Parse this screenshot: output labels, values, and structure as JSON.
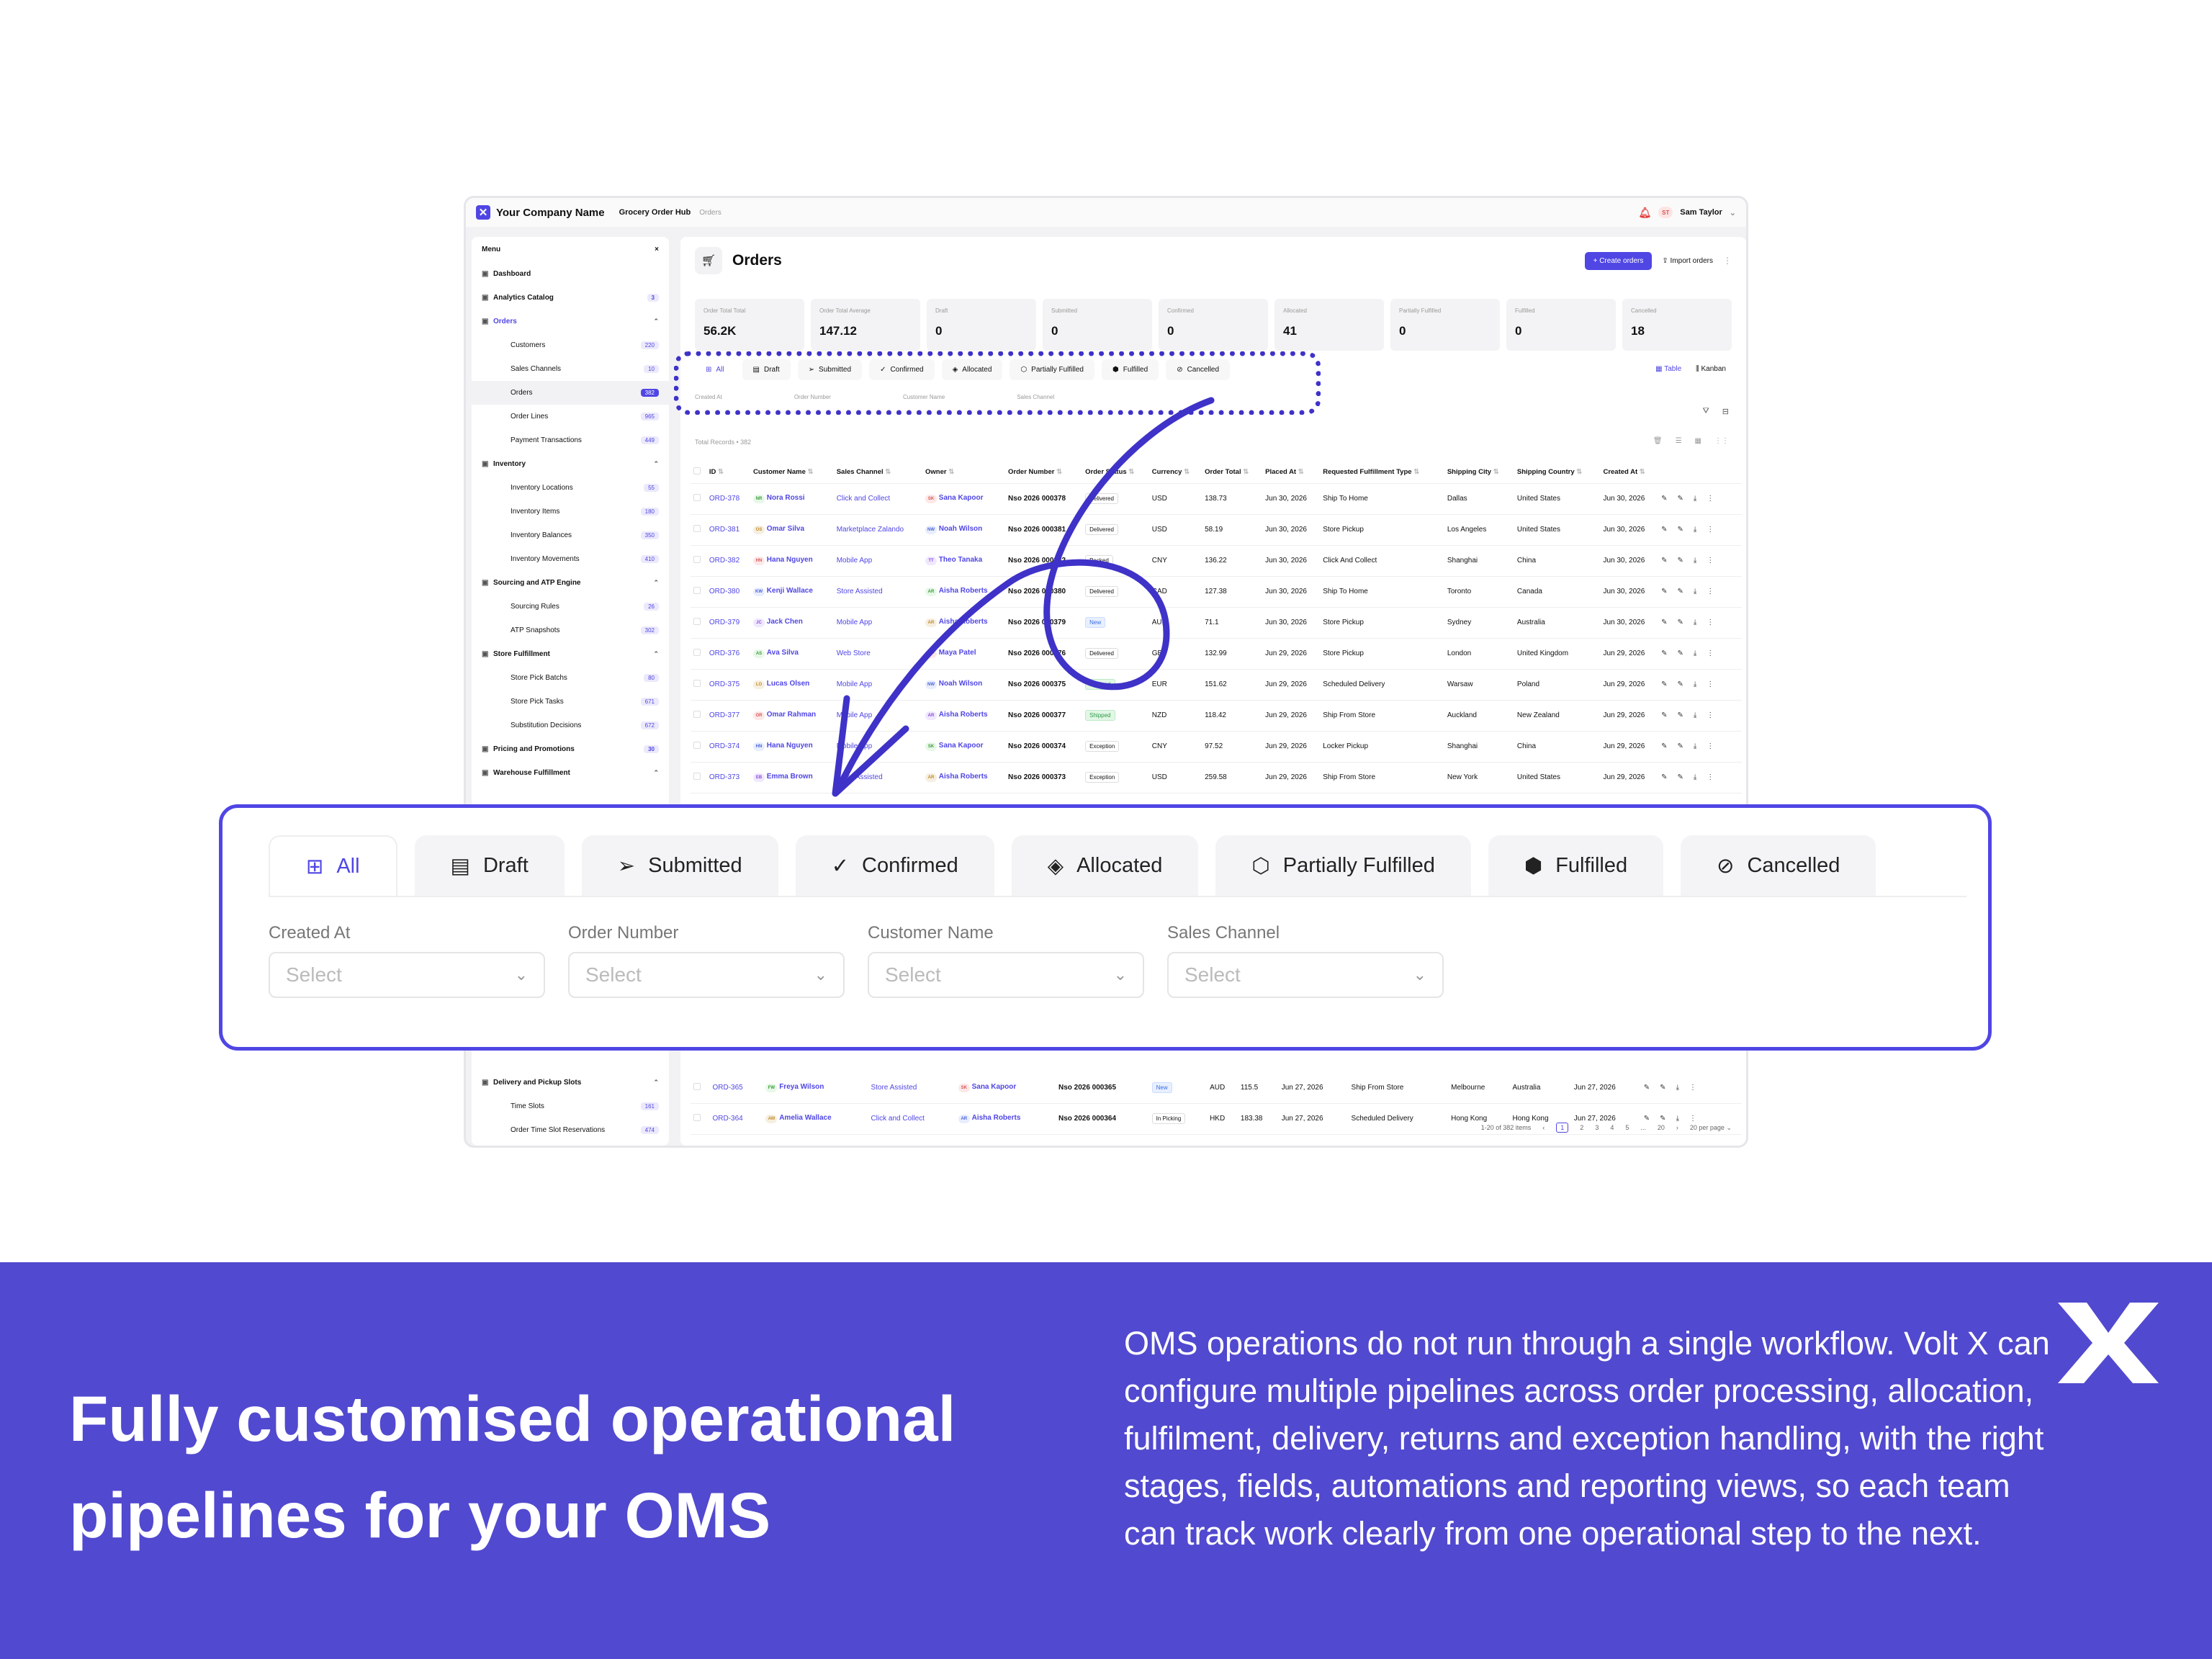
{
  "app": {
    "company": "Your Company Name",
    "hub": "Grocery Order Hub",
    "breadcrumb": "Orders",
    "user": {
      "initials": "ST",
      "name": "Sam Taylor"
    }
  },
  "sidebar": {
    "header": "Menu",
    "close": "×",
    "items": [
      {
        "label": "Dashboard",
        "level": 0
      },
      {
        "label": "Analytics Catalog",
        "badge": "3",
        "level": 0
      },
      {
        "label": "Orders",
        "level": 0,
        "section": true,
        "open": true
      },
      {
        "label": "Customers",
        "badge": "220",
        "level": 1
      },
      {
        "label": "Sales Channels",
        "badge": "10",
        "level": 1
      },
      {
        "label": "Orders",
        "badge": "382",
        "level": 1,
        "active": true
      },
      {
        "label": "Order Lines",
        "badge": "965",
        "level": 1
      },
      {
        "label": "Payment Transactions",
        "badge": "449",
        "level": 1
      },
      {
        "label": "Inventory",
        "level": 0,
        "open": true
      },
      {
        "label": "Inventory Locations",
        "badge": "55",
        "level": 1
      },
      {
        "label": "Inventory Items",
        "badge": "180",
        "level": 1
      },
      {
        "label": "Inventory Balances",
        "badge": "350",
        "level": 1
      },
      {
        "label": "Inventory Movements",
        "badge": "410",
        "level": 1
      },
      {
        "label": "Sourcing and ATP Engine",
        "level": 0,
        "open": true
      },
      {
        "label": "Sourcing Rules",
        "badge": "26",
        "level": 1
      },
      {
        "label": "ATP Snapshots",
        "badge": "302",
        "level": 1
      },
      {
        "label": "Store Fulfillment",
        "level": 0,
        "open": true
      },
      {
        "label": "Store Pick Batchs",
        "badge": "80",
        "level": 1
      },
      {
        "label": "Store Pick Tasks",
        "badge": "671",
        "level": 1
      },
      {
        "label": "Substitution Decisions",
        "badge": "672",
        "level": 1
      },
      {
        "label": "Pricing and Promotions",
        "badge": "30",
        "level": 0
      },
      {
        "label": "Warehouse Fulfillment",
        "level": 0,
        "open": true
      }
    ],
    "bottom_items": [
      {
        "label": "Delivery and Pickup Slots",
        "level": 0,
        "open": true
      },
      {
        "label": "Time Slots",
        "badge": "161",
        "level": 1
      },
      {
        "label": "Order Time Slot Reservations",
        "badge": "474",
        "level": 1
      }
    ]
  },
  "main": {
    "title": "Orders",
    "create_label": "+ Create orders",
    "import_label": "Import orders",
    "stats": [
      {
        "label": "Order Total Total",
        "value": "56.2K"
      },
      {
        "label": "Order Total Average",
        "value": "147.12"
      },
      {
        "label": "Draft",
        "value": "0"
      },
      {
        "label": "Submitted",
        "value": "0"
      },
      {
        "label": "Confirmed",
        "value": "0"
      },
      {
        "label": "Allocated",
        "value": "41"
      },
      {
        "label": "Partially Fulfilled",
        "value": "0"
      },
      {
        "label": "Fulfilled",
        "value": "0"
      },
      {
        "label": "Cancelled",
        "value": "18"
      }
    ],
    "tabs": [
      "All",
      "Draft",
      "Submitted",
      "Confirmed",
      "Allocated",
      "Partially Fulfilled",
      "Fulfilled",
      "Cancelled"
    ],
    "tab_icons": [
      "grid-icon",
      "document-icon",
      "send-icon",
      "check-circle-icon",
      "layers-icon",
      "box-icon",
      "box-check-icon",
      "ban-icon"
    ],
    "views": [
      "Table",
      "Kanban"
    ],
    "filters": [
      "Created At",
      "Order Number",
      "Customer Name",
      "Sales Channel"
    ],
    "filter_placeholder": "Select",
    "records": "Total Records • 382",
    "columns": [
      "ID",
      "Customer Name",
      "Sales Channel",
      "Owner",
      "Order Number",
      "Order Status",
      "Currency",
      "Order Total",
      "Placed At",
      "Requested Fulfillment Type",
      "Shipping City",
      "Shipping Country",
      "Created At"
    ],
    "rows": [
      [
        "ORD-378",
        "NR",
        "Nora Rossi",
        "Click and Collect",
        "SK",
        "Sana Kapoor",
        "Nso 2026 000378",
        "Delivered",
        "USD",
        "138.73",
        "Jun 30, 2026",
        "Ship To Home",
        "Dallas",
        "United States",
        "Jun 30, 2026"
      ],
      [
        "ORD-381",
        "OS",
        "Omar Silva",
        "Marketplace Zalando",
        "NW",
        "Noah Wilson",
        "Nso 2026 000381",
        "Delivered",
        "USD",
        "58.19",
        "Jun 30, 2026",
        "Store Pickup",
        "Los Angeles",
        "United States",
        "Jun 30, 2026"
      ],
      [
        "ORD-382",
        "HN",
        "Hana Nguyen",
        "Mobile App",
        "TT",
        "Theo Tanaka",
        "Nso 2026 000382",
        "Packed",
        "CNY",
        "136.22",
        "Jun 30, 2026",
        "Click And Collect",
        "Shanghai",
        "China",
        "Jun 30, 2026"
      ],
      [
        "ORD-380",
        "KW",
        "Kenji Wallace",
        "Store Assisted",
        "AR",
        "Aisha Roberts",
        "Nso 2026 000380",
        "Delivered",
        "CAD",
        "127.38",
        "Jun 30, 2026",
        "Ship To Home",
        "Toronto",
        "Canada",
        "Jun 30, 2026"
      ],
      [
        "ORD-379",
        "JC",
        "Jack Chen",
        "Mobile App",
        "AR",
        "Aisha Roberts",
        "Nso 2026 000379",
        "New",
        "AUD",
        "71.1",
        "Jun 30, 2026",
        "Store Pickup",
        "Sydney",
        "Australia",
        "Jun 30, 2026"
      ],
      [
        "ORD-376",
        "AS",
        "Ava Silva",
        "Web Store",
        "MP",
        "Maya Patel",
        "Nso 2026 000376",
        "Delivered",
        "GBP",
        "132.99",
        "Jun 29, 2026",
        "Store Pickup",
        "London",
        "United Kingdom",
        "Jun 29, 2026"
      ],
      [
        "ORD-375",
        "LO",
        "Lucas Olsen",
        "Mobile App",
        "NW",
        "Noah Wilson",
        "Nso 2026 000375",
        "Shipped",
        "EUR",
        "151.62",
        "Jun 29, 2026",
        "Scheduled Delivery",
        "Warsaw",
        "Poland",
        "Jun 29, 2026"
      ],
      [
        "ORD-377",
        "OR",
        "Omar Rahman",
        "Mobile App",
        "AR",
        "Aisha Roberts",
        "Nso 2026 000377",
        "Shipped",
        "NZD",
        "118.42",
        "Jun 29, 2026",
        "Ship From Store",
        "Auckland",
        "New Zealand",
        "Jun 29, 2026"
      ],
      [
        "ORD-374",
        "HN",
        "Hana Nguyen",
        "Mobile App",
        "SK",
        "Sana Kapoor",
        "Nso 2026 000374",
        "Exception",
        "CNY",
        "97.52",
        "Jun 29, 2026",
        "Locker Pickup",
        "Shanghai",
        "China",
        "Jun 29, 2026"
      ],
      [
        "ORD-373",
        "EB",
        "Emma Brown",
        "Store Assisted",
        "AR",
        "Aisha Roberts",
        "Nso 2026 000373",
        "Exception",
        "USD",
        "259.58",
        "Jun 29, 2026",
        "Ship From Store",
        "New York",
        "United States",
        "Jun 29, 2026"
      ]
    ],
    "bottom_rows": [
      [
        "ORD-365",
        "FW",
        "Freya Wilson",
        "Store Assisted",
        "SK",
        "Sana Kapoor",
        "Nso 2026 000365",
        "New",
        "AUD",
        "115.5",
        "Jun 27, 2026",
        "Ship From Store",
        "Melbourne",
        "Australia",
        "Jun 27, 2026"
      ],
      [
        "ORD-364",
        "AW",
        "Amelia Wallace",
        "Click and Collect",
        "AR",
        "Aisha Roberts",
        "Nso 2026 000364",
        "In Picking",
        "HKD",
        "183.38",
        "Jun 27, 2026",
        "Scheduled Delivery",
        "Hong Kong",
        "Hong Kong",
        "Jun 27, 2026"
      ]
    ],
    "pager": {
      "summary": "1-20 of 382 items",
      "pages": [
        "1",
        "2",
        "3",
        "4",
        "5",
        "...",
        "20"
      ],
      "per_page": "20 per page"
    }
  },
  "overlay_behind": "Total Records • 382",
  "band": {
    "title": "Fully customised operational pipelines for your OMS",
    "body": "OMS operations do not run through a single workflow. Volt X can configure multiple pipelines across order processing, allocation, fulfilment, delivery, returns and exception handling, with the right stages, fields, automations and reporting views, so each team can track work clearly from one operational step to the next."
  },
  "colors": {
    "accent": "#5046e4",
    "band": "#5149cf",
    "status_new_bg": "#e8f0ff",
    "status_shipped_bg": "#e2f7e6"
  }
}
